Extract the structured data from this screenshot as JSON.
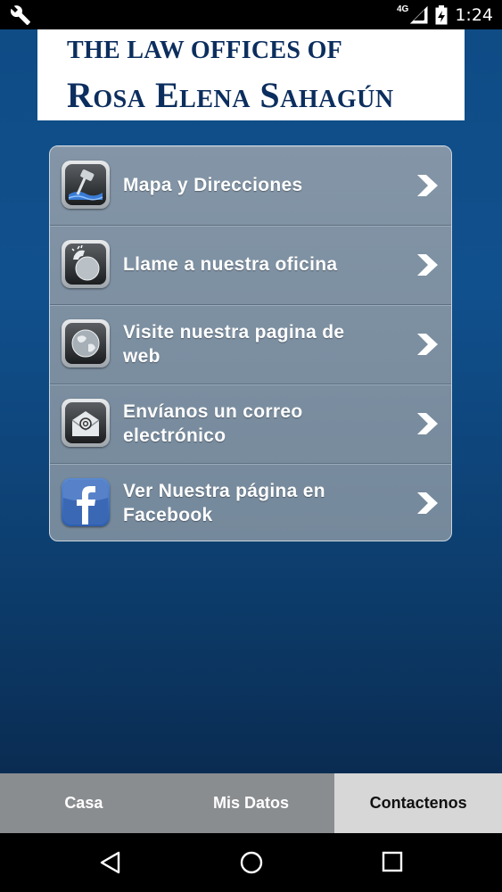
{
  "status_bar": {
    "network": "4G",
    "time": "1:24"
  },
  "banner": {
    "line1": "The Law Offices of",
    "line2": "Rosa Elena Sahagún"
  },
  "menu": {
    "items": [
      {
        "label": "Mapa y Direcciones",
        "icon": "map-pin-icon"
      },
      {
        "label": "Llame a nuestra oficina",
        "icon": "phone-icon"
      },
      {
        "label": "Visite nuestra pagina de web",
        "icon": "globe-icon"
      },
      {
        "label": "Envíanos un correo electrónico",
        "icon": "email-icon"
      },
      {
        "label": "Ver Nuestra página en Facebook",
        "icon": "facebook-icon"
      }
    ]
  },
  "tabs": [
    {
      "label": "Casa",
      "active": false
    },
    {
      "label": "Mis Datos",
      "active": false
    },
    {
      "label": "Contactenos",
      "active": true
    }
  ],
  "colors": {
    "background": "#10508d",
    "banner_text": "#0c2e5e",
    "tab_bar": "#8a8d90",
    "tab_active": "#d7d7d7"
  }
}
